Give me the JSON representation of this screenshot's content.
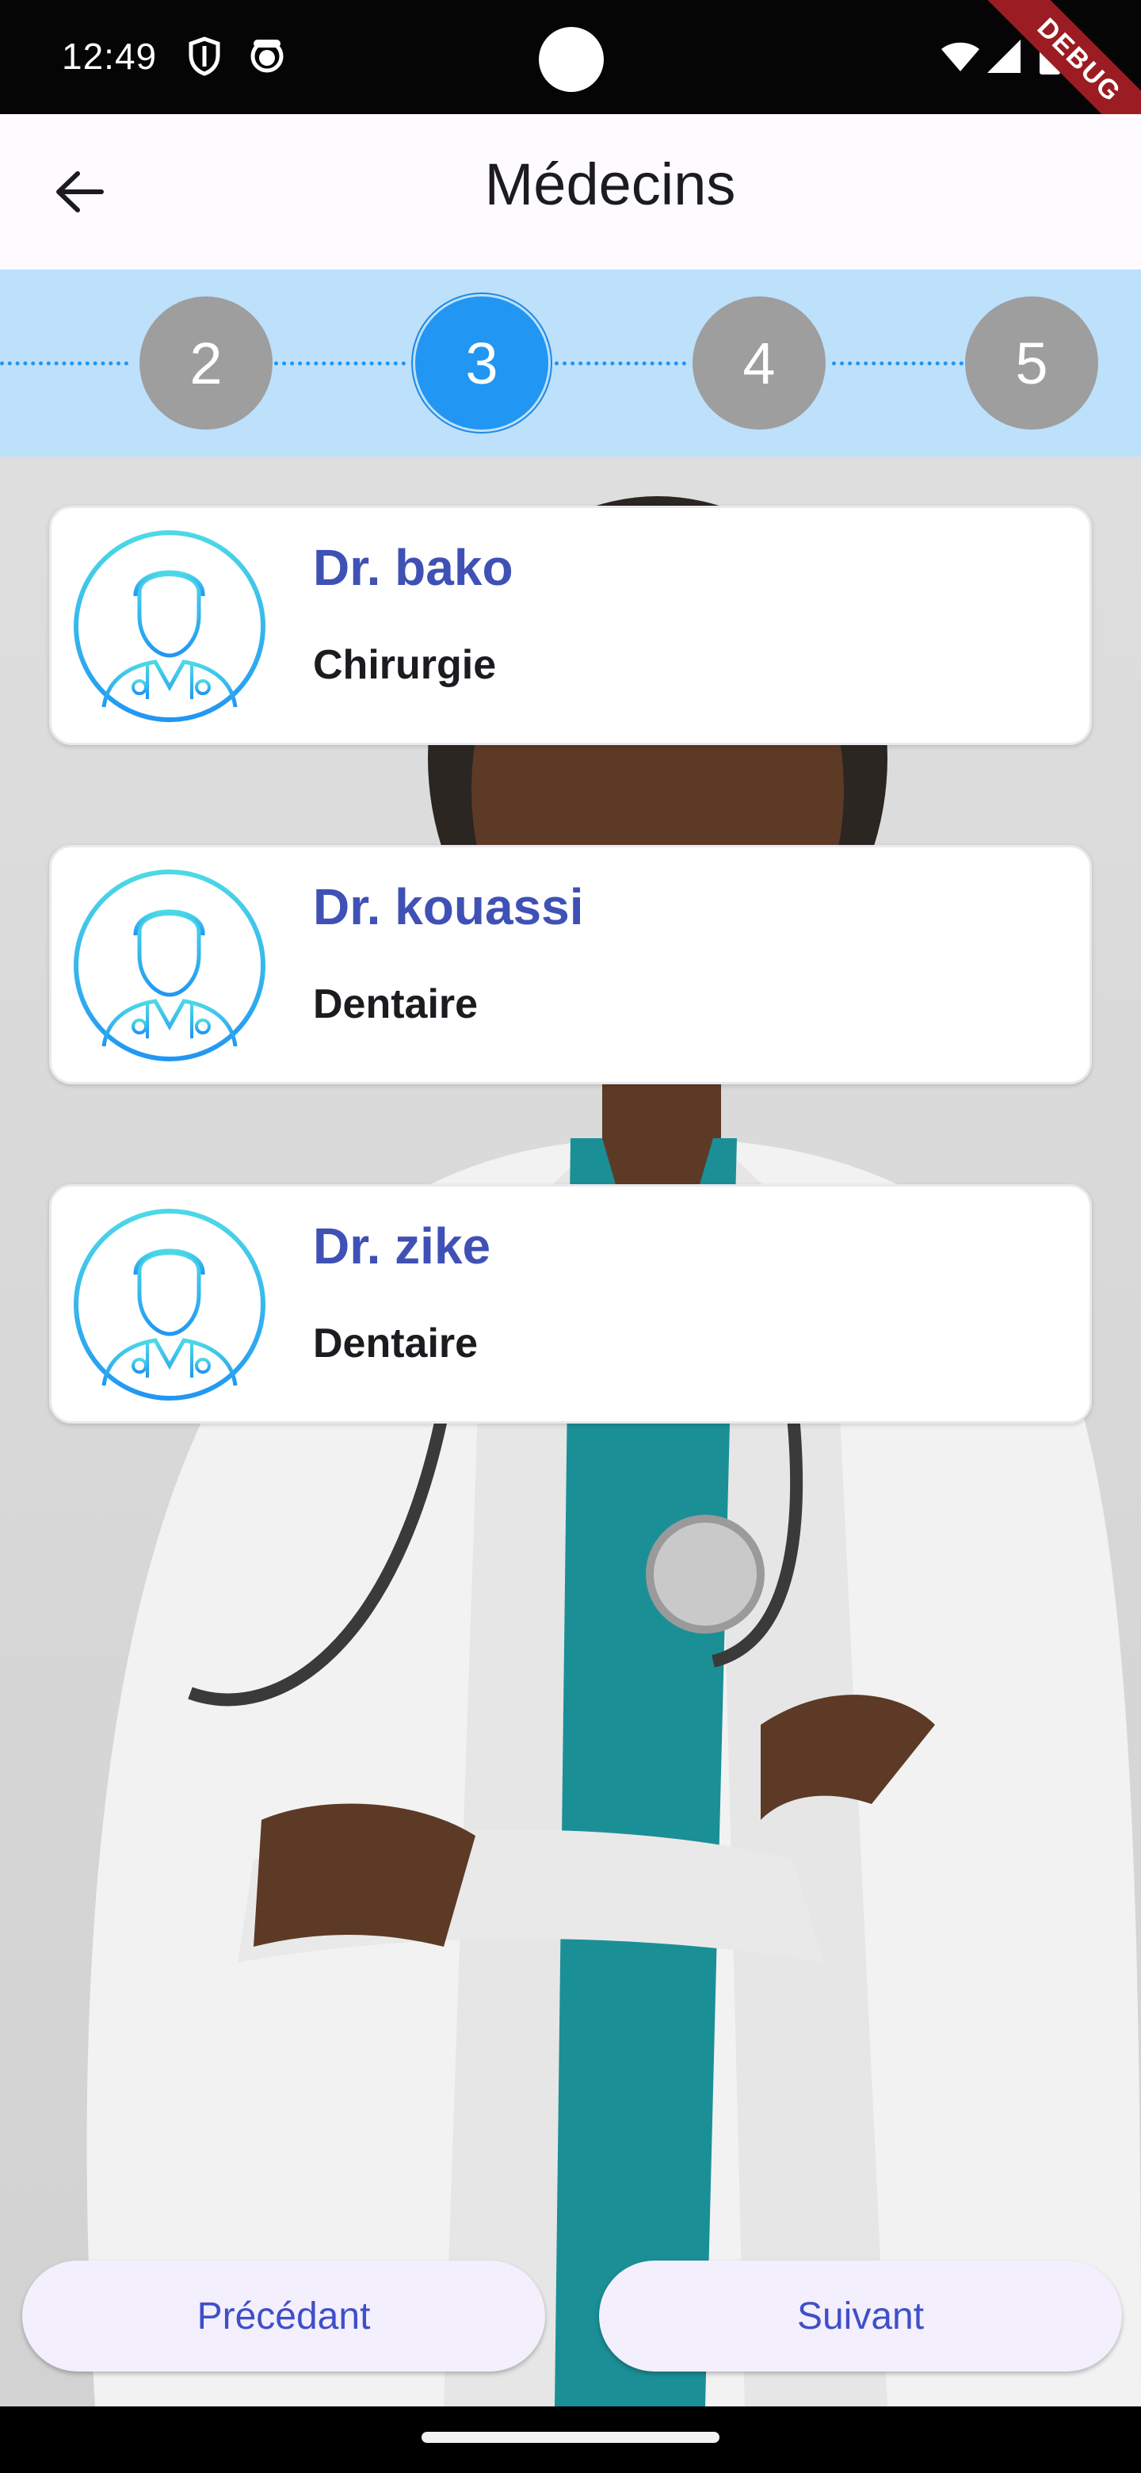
{
  "status_bar": {
    "time": "12:49",
    "icons": [
      "shield-icon",
      "cat-face-icon",
      "wifi-icon",
      "cellular-signal-icon",
      "battery-icon"
    ],
    "debug_banner": "DEBUG"
  },
  "app_bar": {
    "title": "Médecins",
    "back_icon": "arrow-back-icon"
  },
  "stepper": {
    "steps": [
      "2",
      "3",
      "4",
      "5"
    ],
    "active_step": "3",
    "active_color": "#2196f3",
    "inactive_color": "#9e9e9e",
    "background": "#bde0fb"
  },
  "doctors": [
    {
      "name": "Dr. bako",
      "specialty": "Chirurgie",
      "avatar_icon": "doctor-avatar-icon"
    },
    {
      "name": "Dr. kouassi",
      "specialty": "Dentaire",
      "avatar_icon": "doctor-avatar-icon"
    },
    {
      "name": "Dr. zike",
      "specialty": "Dentaire",
      "avatar_icon": "doctor-avatar-icon"
    }
  ],
  "buttons": {
    "previous": "Précédant",
    "next": "Suivant"
  },
  "colors": {
    "doctor_name": "#3f51b5",
    "button_text": "#3f4fc9"
  }
}
